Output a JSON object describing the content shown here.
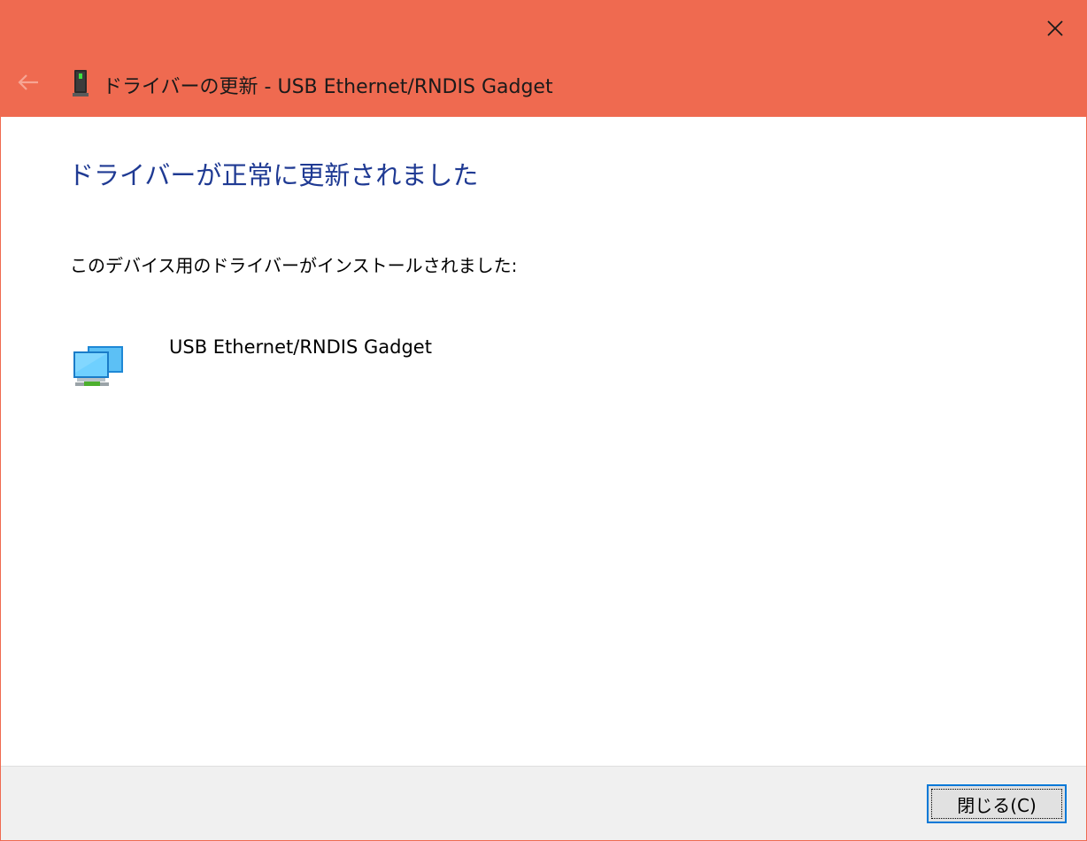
{
  "window": {
    "title": "ドライバーの更新 - USB Ethernet/RNDIS Gadget",
    "accent_color": "#ef6a50"
  },
  "titlebar": {
    "back_icon": "back-arrow-icon",
    "device_icon": "usb-device-icon",
    "close_icon": "close-icon"
  },
  "main": {
    "heading": "ドライバーが正常に更新されました",
    "description": "このデバイス用のドライバーがインストールされました:",
    "device_icon": "network-adapter-icon",
    "device_name": "USB Ethernet/RNDIS Gadget"
  },
  "footer": {
    "close_label": "閉じる(C)"
  }
}
